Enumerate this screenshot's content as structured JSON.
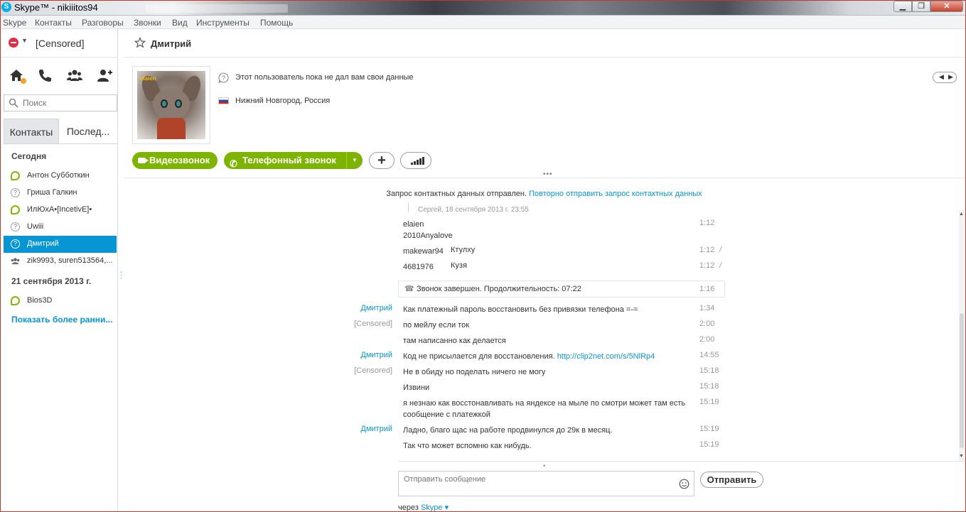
{
  "window": {
    "title": "Skype™ - nikiiitos94",
    "min_label": "▁",
    "max_label": "❐",
    "close_label": "✕"
  },
  "menu": [
    "Skype",
    "Контакты",
    "Разговоры",
    "Звонки",
    "Вид",
    "Инструменты",
    "Помощь"
  ],
  "profile": {
    "name": "[Censored]"
  },
  "search": {
    "placeholder": "Поиск"
  },
  "tabs": {
    "contacts": "Контакты",
    "recent": "Послед..."
  },
  "groups": {
    "today": "Сегодня",
    "date": "21 сентября 2013 г."
  },
  "contacts": [
    {
      "name": "Антон Субботкин",
      "status": "online"
    },
    {
      "name": "Гриша Галкин",
      "status": "unknown"
    },
    {
      "name": "ИлЮхА•[IncetivE]•",
      "status": "online"
    },
    {
      "name": "Uwiii",
      "status": "unknown"
    },
    {
      "name": "Дмитрий",
      "status": "unknown",
      "selected": true
    },
    {
      "name": "zik9993, suren513564,...",
      "status": "group"
    }
  ],
  "older_contacts": [
    {
      "name": "Bios3D",
      "status": "online"
    }
  ],
  "show_more": "Показать более ранни...",
  "chat": {
    "title": "Дмитрий",
    "info_line1": "Этот пользователь пока не дал вам свои данные",
    "info_line2": "Нижний Новгород, Россия",
    "avatar_tag": "elaien",
    "video_call": "Видеозвонок",
    "phone_call": "Телефонный звонок",
    "add_label": "+",
    "request_note": "Запрос контактных данных отправлен.",
    "request_link": "Повторно отправить запрос контактных данных",
    "partial_line": "Сергей, 18 сентября 2013 г. 23:55"
  },
  "messages": [
    {
      "sender": "",
      "text": "elaien",
      "time": "1:12"
    },
    {
      "sender": "",
      "text": "2010Anyalove",
      "time": ""
    },
    {
      "sender": "",
      "text": "makewar94",
      "text2": "Ктулху",
      "time": "1:12",
      "edited": true
    },
    {
      "sender": "",
      "text": "4681976",
      "text2": "Кузя",
      "time": "1:12",
      "edited": true
    },
    {
      "sender": "Дмитрий",
      "text": "Как платежный пароль восстановить без привязки телефона =-=",
      "time": "1:34"
    },
    {
      "sender": "[Censored]",
      "text": "по мейлу если ток",
      "time": "2:00",
      "me": true
    },
    {
      "sender": "",
      "text": "там написанно как делается",
      "time": "2:00"
    },
    {
      "sender": "Дмитрий",
      "text": "Код не присылается для восстановления.",
      "link": "http://clip2net.com/s/5NlRp4",
      "time": "14:55"
    },
    {
      "sender": "[Censored]",
      "text": "Не в обиду но поделать ничего не могу",
      "time": "15:18",
      "me": true
    },
    {
      "sender": "",
      "text": "Извини",
      "time": "15:18"
    },
    {
      "sender": "",
      "text": "я незнаю как восстонавливать на яндексе на мыле по смотри может там есть сообщение с платежкой",
      "time": "15:19"
    },
    {
      "sender": "Дмитрий",
      "text": "Ладно, благо щас на работе продвинулся до 29к в месяц.",
      "time": "15:19"
    },
    {
      "sender": "",
      "text": "Так что может вспомню как нибудь.",
      "time": "15:19"
    }
  ],
  "call_ended": {
    "text": "Звонок завершен. Продолжительность: 07:22",
    "time": "1:16"
  },
  "composer": {
    "placeholder": "Отправить сообщение",
    "send": "Отправить",
    "via": "через",
    "via_service": "Skype"
  },
  "colors": {
    "accent": "#0895d3",
    "call_green": "#7db400",
    "away": "#f8a122"
  }
}
